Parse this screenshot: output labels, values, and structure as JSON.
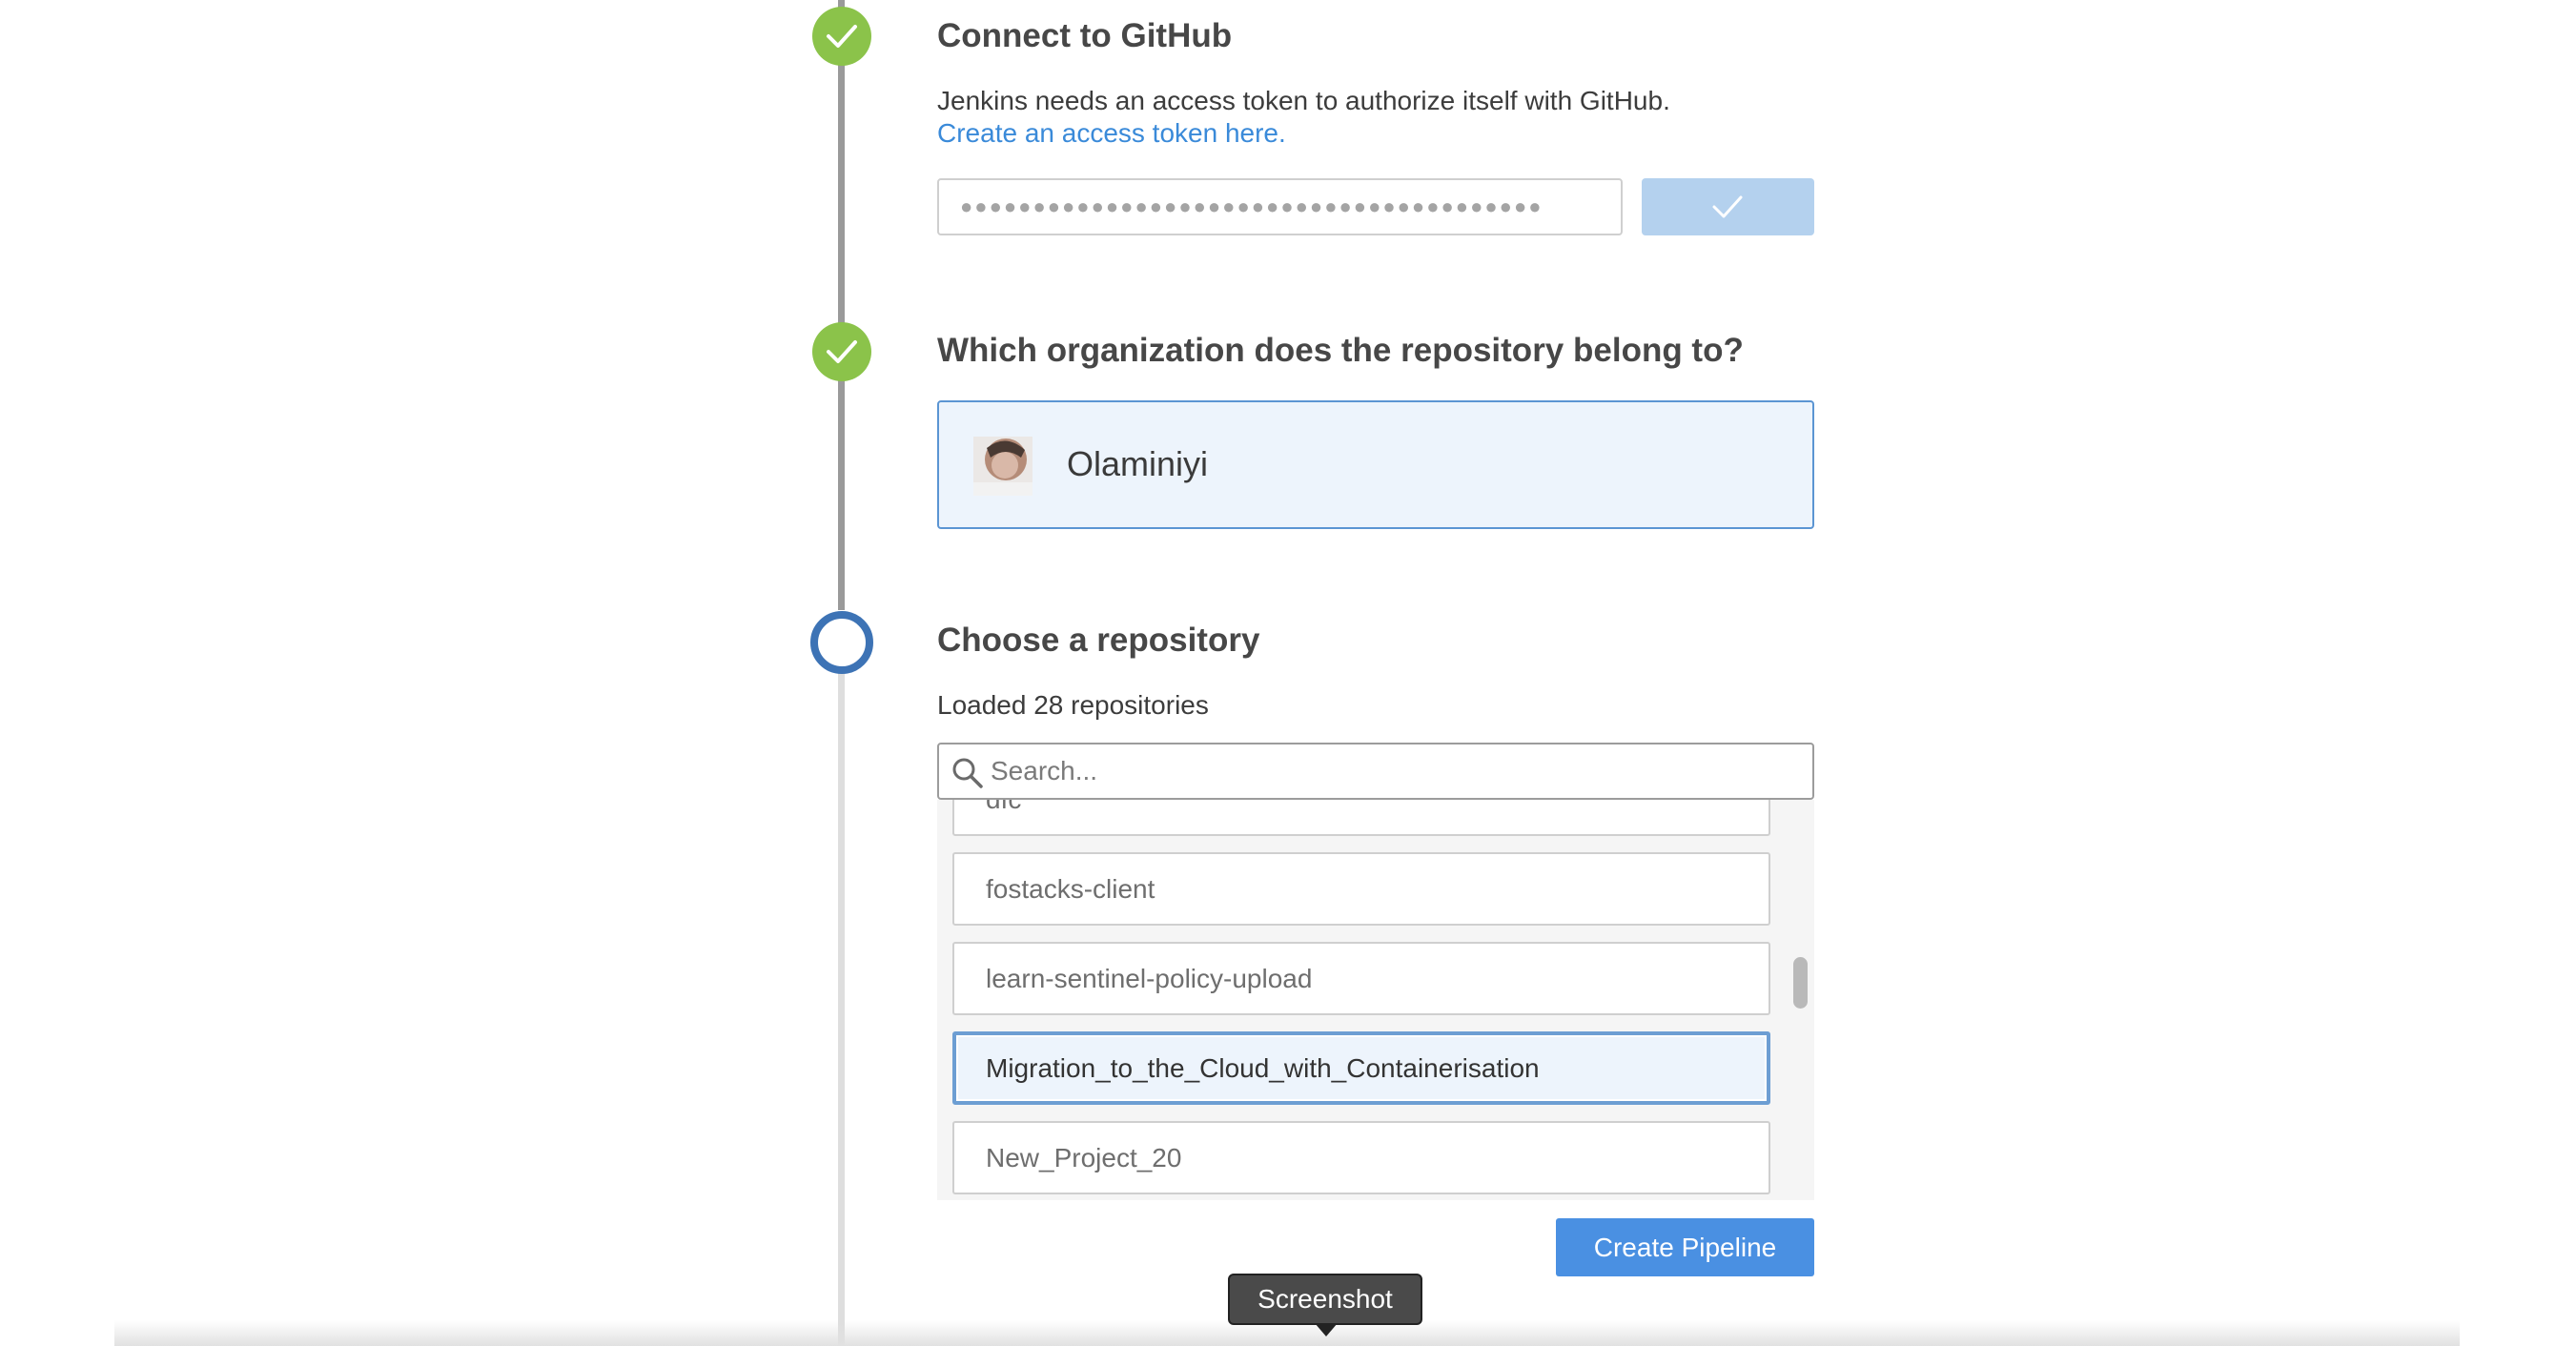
{
  "steps": {
    "connect": {
      "title": "Connect to GitHub",
      "description": "Jenkins needs an access token to authorize itself with GitHub.",
      "link": "Create an access token here.",
      "token_mask": "●●●●●●●●●●●●●●●●●●●●●●●●●●●●●●●●●●●●●●●●",
      "status": "complete"
    },
    "organization": {
      "title": "Which organization does the repository belong to?",
      "selected_org": "Olaminiyi",
      "status": "complete"
    },
    "repository": {
      "title": "Choose a repository",
      "loaded_text": "Loaded 28 repositories",
      "search_placeholder": "Search...",
      "status": "current",
      "items": [
        {
          "name": "dfc",
          "selected": false
        },
        {
          "name": "fostacks-client",
          "selected": false
        },
        {
          "name": "learn-sentinel-policy-upload",
          "selected": false
        },
        {
          "name": "Migration_to_the_Cloud_with_Containerisation",
          "selected": true
        },
        {
          "name": "New_Project_20",
          "selected": false
        }
      ]
    }
  },
  "actions": {
    "create_pipeline": "Create Pipeline"
  },
  "tooltip": {
    "label": "Screenshot"
  },
  "colors": {
    "complete": "#8bc34a",
    "current": "#3d73b5",
    "link": "#3a8ad9",
    "primary_button": "#4a90e2",
    "selection_bg": "#edf4fc"
  },
  "icons": {
    "step_complete": "check-icon",
    "token_submit": "check-icon",
    "search": "search-icon"
  }
}
